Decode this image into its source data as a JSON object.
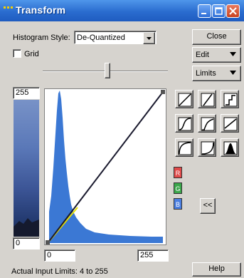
{
  "window": {
    "title": "Transform"
  },
  "histogram": {
    "style_label": "Histogram Style:",
    "style_value": "De-Quantized"
  },
  "grid_label": "Grid",
  "buttons": {
    "close": "Close",
    "edit": "Edit",
    "limits": "Limits",
    "help": "Help",
    "collapse": "<<"
  },
  "channels": {
    "red": "R",
    "green": "G",
    "blue": "B"
  },
  "output_max": "255",
  "output_min": "0",
  "input_min": "0",
  "input_max": "255",
  "actual_limits": "Actual Input Limits: 4 to 255",
  "colors": {
    "title_bar": "#2a6ccf",
    "histogram": "#3b78d4",
    "transform_line": "#1a1a2e",
    "highlight_line": "#e8e000"
  }
}
